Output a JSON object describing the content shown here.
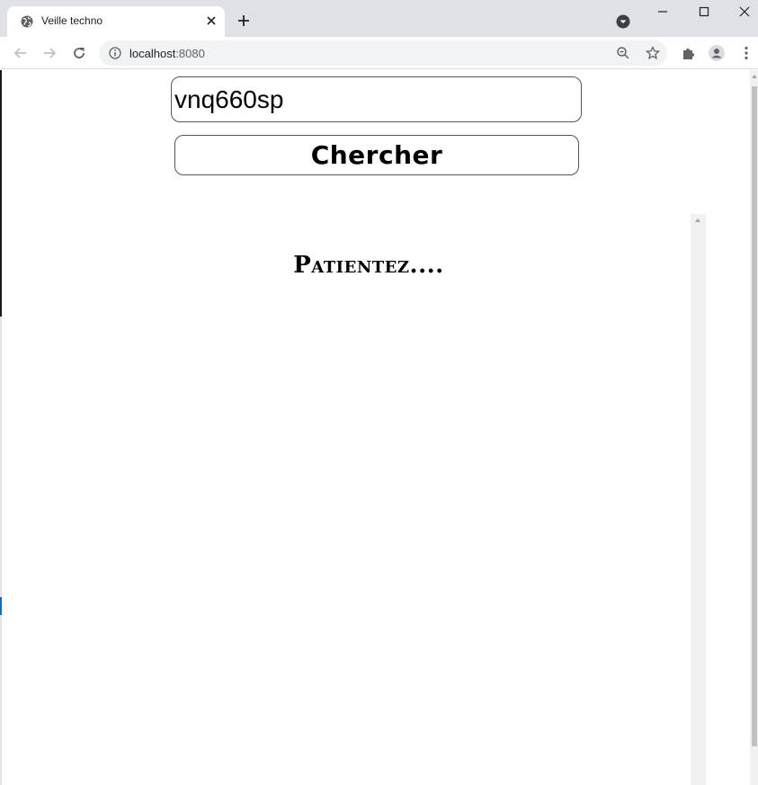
{
  "browser": {
    "tab_title": "Veille techno",
    "url_host": "localhost",
    "url_port": ":8080",
    "icons": {
      "favicon": "globe-icon",
      "close": "close-icon",
      "new_tab": "plus-icon",
      "tab_search": "tab-search-icon",
      "minimize": "minimize-icon",
      "maximize": "maximize-icon",
      "window_close": "window-close-icon",
      "back": "back-arrow-icon",
      "forward": "forward-arrow-icon",
      "reload": "reload-icon",
      "site_info": "info-icon",
      "zoom": "zoom-icon",
      "bookmark": "star-icon",
      "extensions": "puzzle-icon",
      "profile": "profile-icon",
      "menu": "kebab-menu-icon"
    }
  },
  "page": {
    "search": {
      "value": "vnq660sp"
    },
    "search_button_label": "Chercher",
    "status_text": "Patientez...."
  }
}
